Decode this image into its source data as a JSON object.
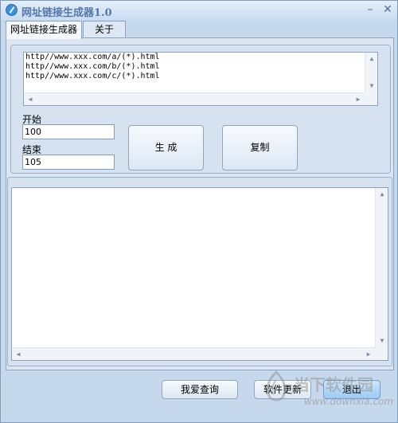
{
  "window": {
    "title": "网址链接生成器1.0"
  },
  "tabs": [
    {
      "label": "网址链接生成器",
      "active": true
    },
    {
      "label": "关于",
      "active": false
    }
  ],
  "url_template": {
    "lines": [
      "http//www.xxx.com/a/(*).html",
      "http//www.xxx.com/b/(*).html",
      "http//www.xxx.com/c/(*).html"
    ]
  },
  "range": {
    "start_label": "开始",
    "start_value": "100",
    "end_label": "结束",
    "end_value": "105"
  },
  "actions": {
    "generate_label": "生 成",
    "copy_label": "复制"
  },
  "footer": {
    "query_label": "我爱查询",
    "update_label": "软件更新",
    "exit_label": "退出"
  },
  "watermark": {
    "text": "当下软件园",
    "url": "www.downxia.com"
  },
  "colors": {
    "window_bg": "#c6d8ec",
    "accent": "#9ccaf3"
  }
}
